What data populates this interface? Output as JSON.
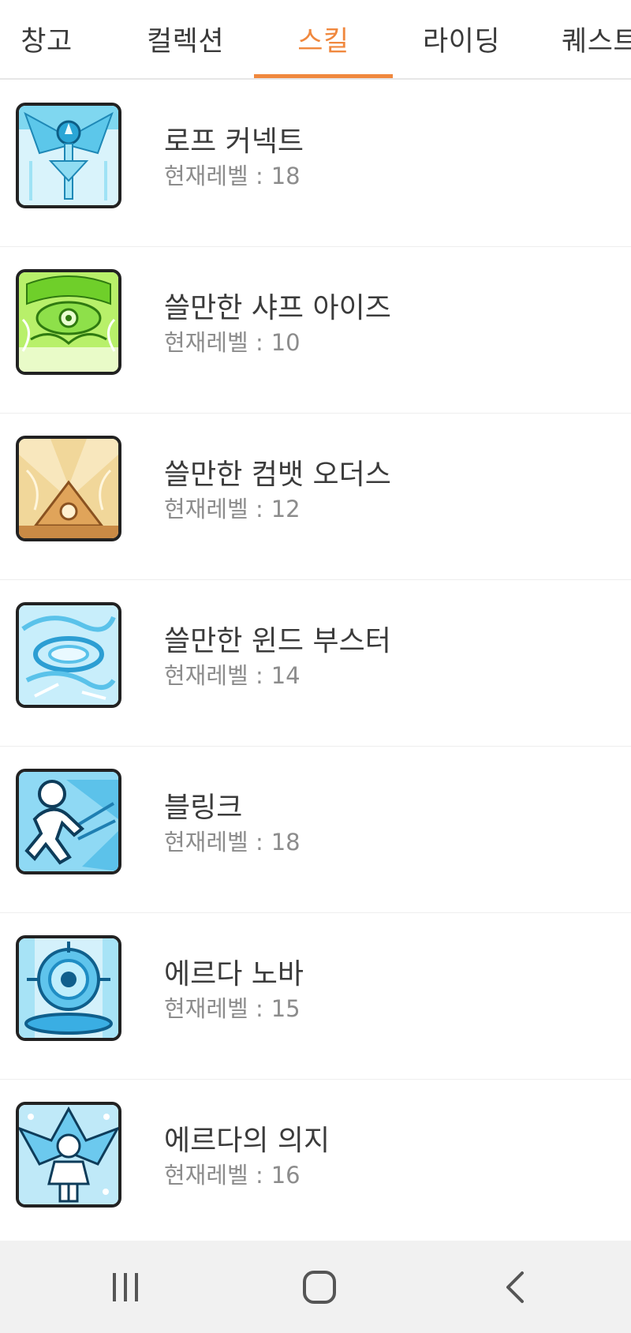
{
  "tabs": [
    {
      "label": "창고"
    },
    {
      "label": "컬렉션"
    },
    {
      "label": "스킬"
    },
    {
      "label": "라이딩"
    },
    {
      "label": "퀘스트"
    }
  ],
  "active_tab": "스킬",
  "accent_color": "#f0883e",
  "level_label": "현재레벨 :",
  "skills": [
    {
      "name": "로프 커넥트",
      "level": "18",
      "icon": "rope-connect-skill-icon"
    },
    {
      "name": "쓸만한 샤프 아이즈",
      "level": "10",
      "icon": "sharp-eyes-skill-icon"
    },
    {
      "name": "쓸만한 컴뱃 오더스",
      "level": "12",
      "icon": "combat-orders-skill-icon"
    },
    {
      "name": "쓸만한 윈드 부스터",
      "level": "14",
      "icon": "wind-booster-skill-icon"
    },
    {
      "name": "블링크",
      "level": "18",
      "icon": "blink-skill-icon"
    },
    {
      "name": "에르다 노바",
      "level": "15",
      "icon": "erda-nova-skill-icon"
    },
    {
      "name": "에르다의 의지",
      "level": "16",
      "icon": "erda-will-skill-icon"
    }
  ],
  "navbar": {
    "recent_icon": "recent-apps-icon",
    "home_icon": "home-icon",
    "back_icon": "back-icon"
  }
}
